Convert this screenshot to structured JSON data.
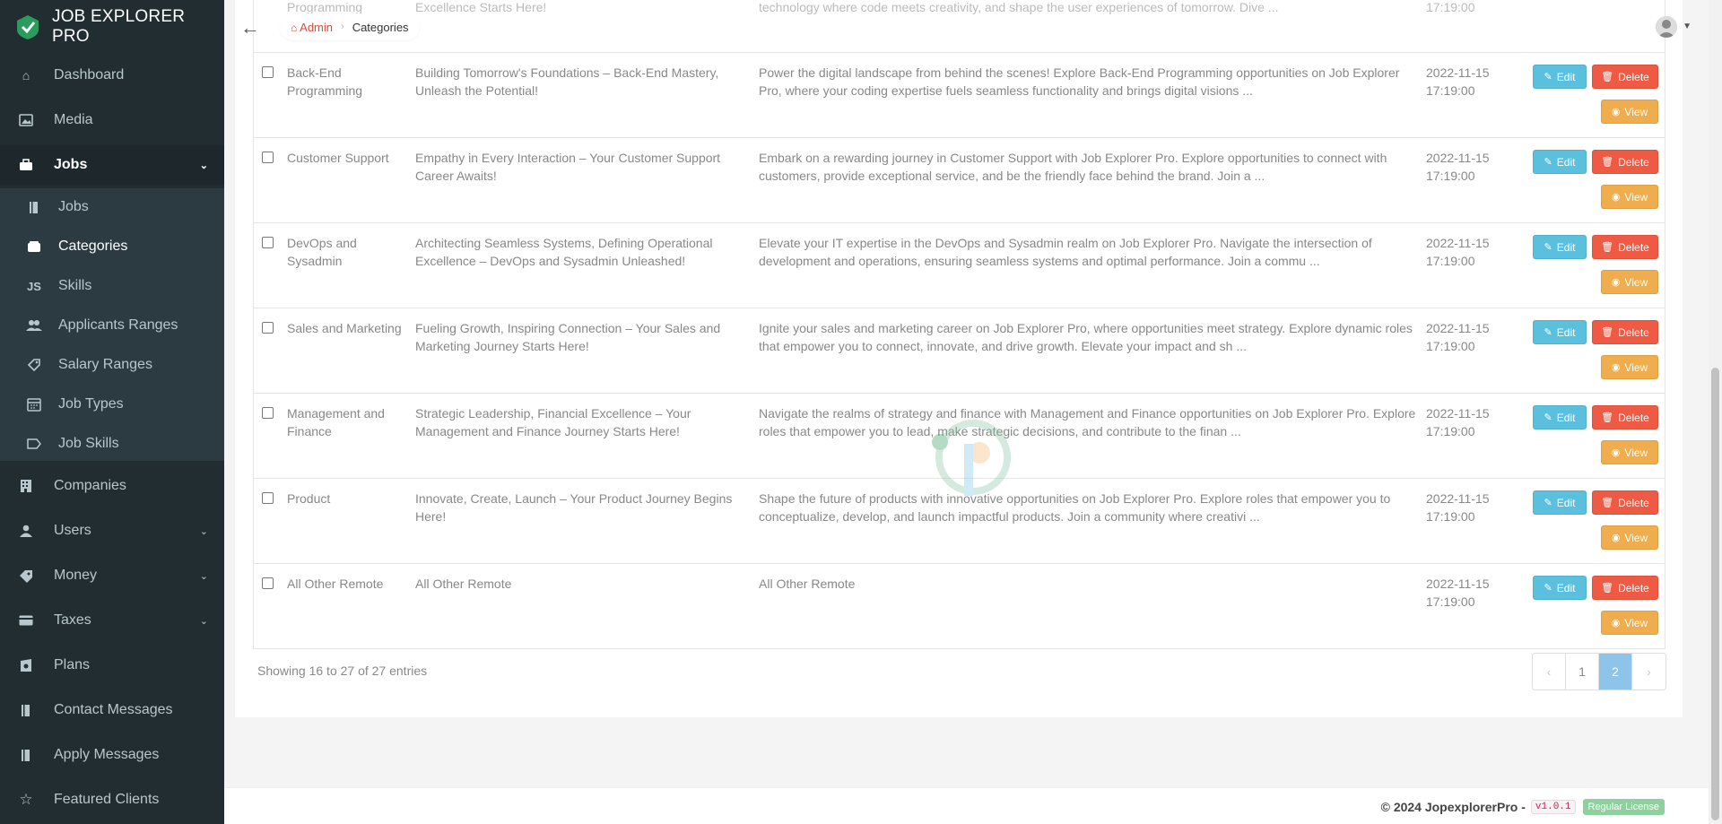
{
  "app": {
    "brand": "JOB EXPLORER PRO"
  },
  "sidebar": {
    "items": [
      {
        "label": "Dashboard",
        "icon": "home-icon"
      },
      {
        "label": "Media",
        "icon": "image-icon"
      },
      {
        "label": "Jobs",
        "icon": "briefcase-icon"
      },
      {
        "label": "Jobs",
        "icon": "book-icon"
      },
      {
        "label": "Categories",
        "icon": "box-icon"
      },
      {
        "label": "Skills",
        "icon": "js-icon"
      },
      {
        "label": "Applicants Ranges",
        "icon": "users-icon"
      },
      {
        "label": "Salary Ranges",
        "icon": "tag-icon"
      },
      {
        "label": "Job Types",
        "icon": "calendar-icon"
      },
      {
        "label": "Job Skills",
        "icon": "label-icon"
      },
      {
        "label": "Companies",
        "icon": "building-icon"
      },
      {
        "label": "Users",
        "icon": "user-icon"
      },
      {
        "label": "Money",
        "icon": "money-icon"
      },
      {
        "label": "Taxes",
        "icon": "card-icon"
      },
      {
        "label": "Plans",
        "icon": "wallet-icon"
      },
      {
        "label": "Contact Messages",
        "icon": "book-icon"
      },
      {
        "label": "Apply Messages",
        "icon": "book-icon"
      },
      {
        "label": "Featured Clients",
        "icon": "star-icon"
      }
    ]
  },
  "breadcrumb": {
    "home": "Admin",
    "current": "Categories"
  },
  "table": {
    "rows": [
      {
        "name": "Back-End Programming",
        "title": "Building Tomorrow's Foundations – Back-End Mastery, Unleash the Potential!",
        "description": "Power the digital landscape from behind the scenes! Explore Back-End Programming opportunities on Job Explorer Pro, where your coding expertise fuels seamless functionality and brings digital visions ...",
        "date": "2022-11-15 17:19:00"
      },
      {
        "name": "Customer Support",
        "title": "Empathy in Every Interaction – Your Customer Support Career Awaits!",
        "description": "Embark on a rewarding journey in Customer Support with Job Explorer Pro. Explore opportunities to connect with customers, provide exceptional service, and be the friendly face behind the brand. Join a ...",
        "date": "2022-11-15 17:19:00"
      },
      {
        "name": "DevOps and Sysadmin",
        "title": "Architecting Seamless Systems, Defining Operational Excellence – DevOps and Sysadmin Unleashed!",
        "description": "Elevate your IT expertise in the DevOps and Sysadmin realm on Job Explorer Pro. Navigate the intersection of development and operations, ensuring seamless systems and optimal performance. Join a commu ...",
        "date": "2022-11-15 17:19:00"
      },
      {
        "name": "Sales and Marketing",
        "title": "Fueling Growth, Inspiring Connection – Your Sales and Marketing Journey Starts Here!",
        "description": "Ignite your sales and marketing career on Job Explorer Pro, where opportunities meet strategy. Explore dynamic roles that empower you to connect, innovate, and drive growth. Elevate your impact and sh ...",
        "date": "2022-11-15 17:19:00"
      },
      {
        "name": "Management and Finance",
        "title": "Strategic Leadership, Financial Excellence – Your Management and Finance Journey Starts Here!",
        "description": "Navigate the realms of strategy and finance with Management and Finance opportunities on Job Explorer Pro. Explore roles that empower you to lead, make strategic decisions, and contribute to the finan ...",
        "date": "2022-11-15 17:19:00"
      },
      {
        "name": "Product",
        "title": "Innovate, Create, Launch – Your Product Journey Begins Here!",
        "description": "Shape the future of products with innovative opportunities on Job Explorer Pro. Explore roles that empower you to conceptualize, develop, and launch impactful products. Join a community where creativi ...",
        "date": "2022-11-15 17:19:00"
      },
      {
        "name": "All Other Remote",
        "title": "All Other Remote",
        "description": "All Other Remote",
        "date": "2022-11-15 17:19:00"
      }
    ],
    "buttons": {
      "edit": "Edit",
      "delete": "Delete",
      "view": "View"
    },
    "partial_top_row": {
      "name": "Programming",
      "title": "Excellence Starts Here!",
      "description": "technology where code meets creativity, and shape the user experiences of tomorrow. Dive ...",
      "date": "17:19:00"
    }
  },
  "pagination": {
    "info": "Showing 16 to 27 of 27 entries",
    "prev": "‹",
    "pages": [
      "1",
      "2"
    ],
    "active_page": "2",
    "next": "›"
  },
  "footer": {
    "copyright": "© 2024 JopexplorerPro -",
    "version": "v1.0.1",
    "license": "Regular License"
  },
  "colors": {
    "sidebar_bg": "#222d32",
    "edit": "#5bc0de",
    "delete": "#ee5a43",
    "view": "#f0ad4e",
    "accent": "#dd4b39"
  }
}
